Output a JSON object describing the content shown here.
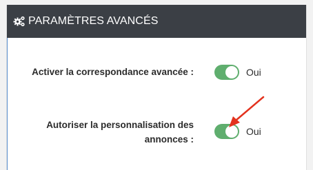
{
  "header": {
    "title": "PARAMÈTRES AVANCÉS",
    "icon": "gears-icon"
  },
  "settings": [
    {
      "label": "Activer la correspondance avancée :",
      "value": "Oui",
      "enabled": true
    },
    {
      "label_line1": "Autoriser la personnalisation des",
      "label_line2": "annonces :",
      "value": "Oui",
      "enabled": true
    }
  ],
  "colors": {
    "header_bg": "#3b3f45",
    "toggle_on": "#5fae6e",
    "arrow": "#e3321e"
  }
}
